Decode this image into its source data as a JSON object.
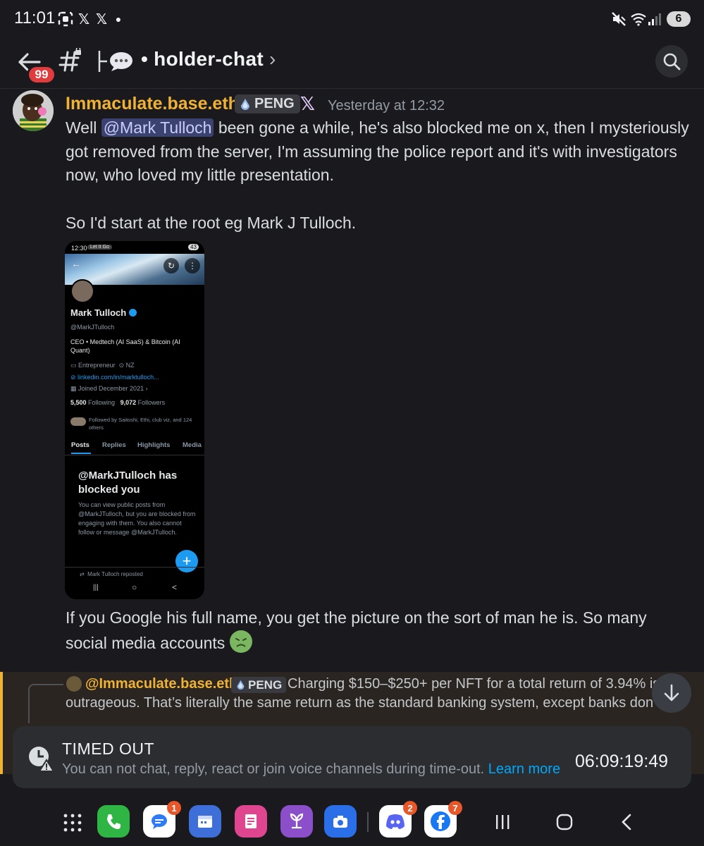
{
  "status_bar": {
    "time": "11:01",
    "battery": "6",
    "icons": [
      "screenshot-icon",
      "x-app-icon",
      "x-app-icon",
      "dot-icon",
      "mute-icon",
      "wifi-icon",
      "signal-icon"
    ]
  },
  "header": {
    "back_badge": "99",
    "thread_icon": "thread-icon",
    "channel": "• holder-chat",
    "chevron": "›"
  },
  "message": {
    "author": "Immaculate.base.eth",
    "role_tag": "PENG",
    "timestamp": "Yesterday at 12:32",
    "text_before_mention": "Well ",
    "mention": "@Mark Tulloch",
    "text_after_mention": " been gone a while, he's also blocked me on x, then I mysteriously got removed from the server, I'm  assuming the police report and it's with investigators now, who loved my little presentation.",
    "paragraph_2": "So I'd start at the root eg Mark J Tulloch.",
    "paragraph_3": "If you Google his full name, you get the picture on the sort of man he is. So many social media accounts"
  },
  "attachment": {
    "phone_time": "12:30",
    "phone_notice": "Let It Go",
    "phone_battery": "43",
    "display_name": "Mark Tulloch",
    "handle": "@MarkJTulloch",
    "bio": "CEO • Medtech (AI SaaS) & Bitcoin (AI Quant)",
    "category": "Entrepreneur",
    "location": "NZ",
    "link": "linkedin.com/in/marktulloch...",
    "joined": "Joined December 2021",
    "following_count": "5,500",
    "following_label": "Following",
    "followers_count": "9,072",
    "followers_label": "Followers",
    "followed_by": "Followed by Saitoshi, Ethi, club viz, and 124 others",
    "tabs": [
      "Posts",
      "Replies",
      "Highlights",
      "Media"
    ],
    "blocked_title": "@MarkJTulloch has blocked you",
    "blocked_desc": "You can view public posts from @MarkJTulloch, but you are blocked from engaging with them. You also cannot follow or message @MarkJTulloch.",
    "reposted": "Mark Tulloch reposted",
    "nav": [
      "|||",
      "○",
      "<"
    ]
  },
  "reply": {
    "author": "@Immaculate.base.eth",
    "role_tag": "PENG",
    "text_1": "Charging $150–$250+ per NFT for a total return of 3.94% is",
    "text_2": "outrageous. That’s literally the same return as the standard banking system, except banks don’t:"
  },
  "timeout": {
    "title": "TIMED OUT",
    "description": "You can not chat, reply, react or join voice channels during time-out.",
    "link": "Learn more",
    "timer": "06:09:19:49"
  },
  "dock": {
    "apps": [
      {
        "name": "phone",
        "color": "#2fb544",
        "badge": ""
      },
      {
        "name": "messages",
        "color": "#ffffff",
        "badge": "1"
      },
      {
        "name": "calendar",
        "color": "#3e6fd8",
        "badge": ""
      },
      {
        "name": "notes",
        "color": "#e0468f",
        "badge": ""
      },
      {
        "name": "garden",
        "color": "#8b4fc9",
        "badge": ""
      },
      {
        "name": "camera",
        "color": "#2b6fe8",
        "badge": ""
      },
      {
        "name": "discord",
        "color": "#ffffff",
        "badge": "2"
      },
      {
        "name": "facebook",
        "color": "#ffffff",
        "badge": "7"
      }
    ]
  }
}
